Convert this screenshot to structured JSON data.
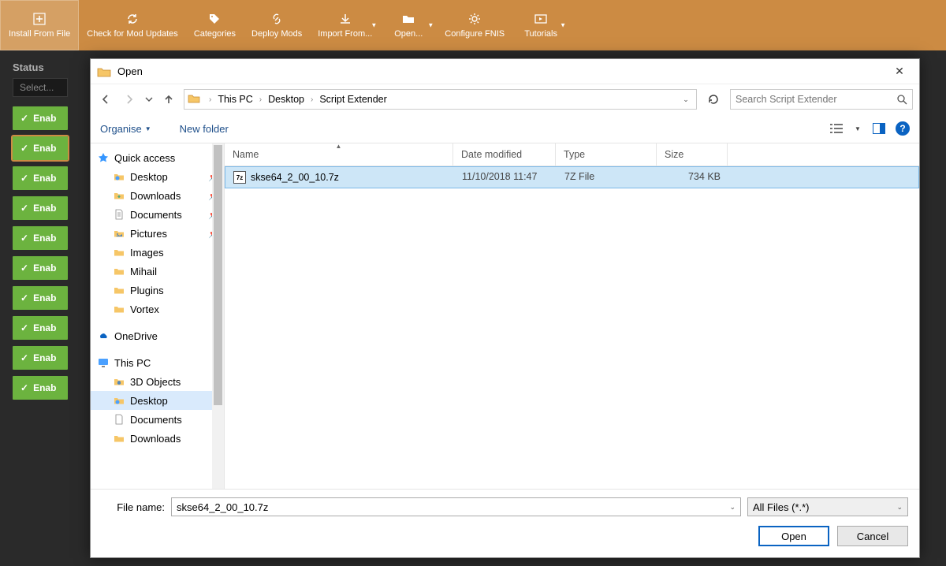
{
  "vortex": {
    "toolbar": [
      {
        "label": "Install From File",
        "icon": "plus"
      },
      {
        "label": "Check for Mod Updates",
        "icon": "refresh"
      },
      {
        "label": "Categories",
        "icon": "tag"
      },
      {
        "label": "Deploy Mods",
        "icon": "link"
      },
      {
        "label": "Import From...",
        "icon": "download",
        "dropdown": true
      },
      {
        "label": "Open...",
        "icon": "folder",
        "dropdown": true
      },
      {
        "label": "Configure FNIS",
        "icon": "gear"
      },
      {
        "label": "Tutorials",
        "icon": "video",
        "dropdown": true
      }
    ],
    "status_label": "Status",
    "status_select": "Select...",
    "enabled_label": "Enab"
  },
  "dialog": {
    "title": "Open",
    "breadcrumbs": [
      "This PC",
      "Desktop",
      "Script Extender"
    ],
    "search_placeholder": "Search Script Extender",
    "organise": "Organise",
    "new_folder": "New folder",
    "columns": {
      "name": "Name",
      "date": "Date modified",
      "type": "Type",
      "size": "Size"
    },
    "sidebar": {
      "quick_access": "Quick access",
      "onedrive": "OneDrive",
      "this_pc": "This PC",
      "items_qa": [
        {
          "label": "Desktop",
          "pinned": true
        },
        {
          "label": "Downloads",
          "pinned": true
        },
        {
          "label": "Documents",
          "pinned": true
        },
        {
          "label": "Pictures",
          "pinned": true
        },
        {
          "label": "Images"
        },
        {
          "label": "Mihail"
        },
        {
          "label": "Plugins"
        },
        {
          "label": "Vortex"
        }
      ],
      "items_pc": [
        {
          "label": "3D Objects"
        },
        {
          "label": "Desktop",
          "selected": true
        },
        {
          "label": "Documents"
        },
        {
          "label": "Downloads"
        }
      ]
    },
    "files": [
      {
        "name": "skse64_2_00_10.7z",
        "date": "11/10/2018 11:47",
        "type": "7Z File",
        "size": "734 KB",
        "selected": true
      }
    ],
    "filename_label": "File name:",
    "filename_value": "skse64_2_00_10.7z",
    "filter": "All Files (*.*)",
    "open_btn": "Open",
    "cancel_btn": "Cancel"
  }
}
